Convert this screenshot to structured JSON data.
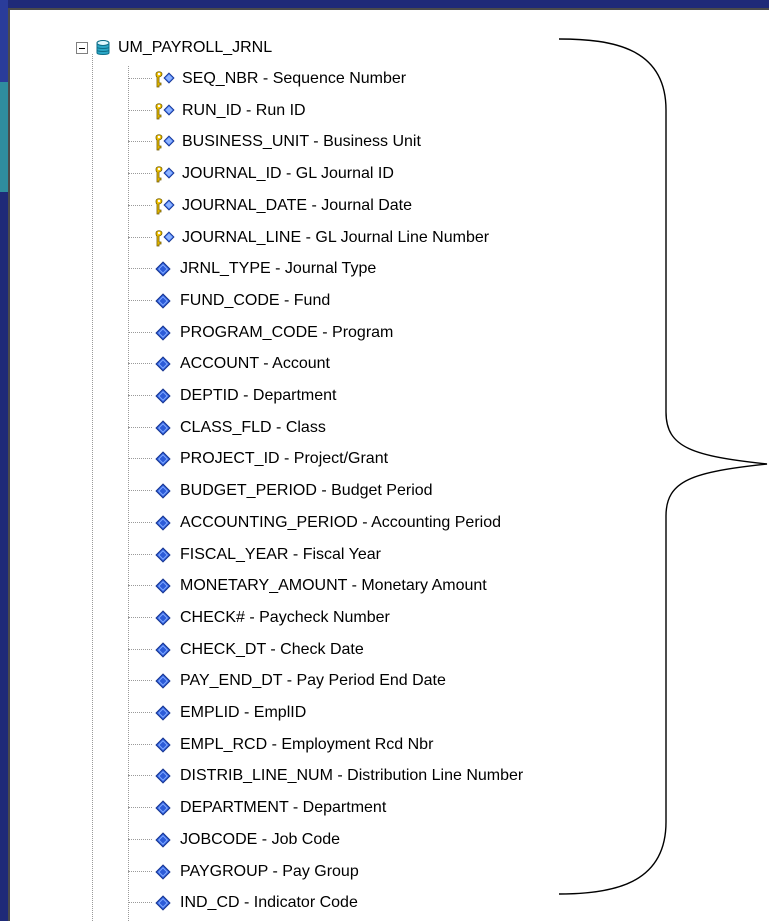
{
  "tree": {
    "root": "UM_PAYROLL_JRNL",
    "items": [
      {
        "label": "SEQ_NBR - Sequence Number",
        "is_key": true
      },
      {
        "label": "RUN_ID - Run ID",
        "is_key": true
      },
      {
        "label": "BUSINESS_UNIT - Business Unit",
        "is_key": true
      },
      {
        "label": "JOURNAL_ID - GL Journal ID",
        "is_key": true
      },
      {
        "label": "JOURNAL_DATE - Journal Date",
        "is_key": true
      },
      {
        "label": "JOURNAL_LINE - GL Journal Line Number",
        "is_key": true
      },
      {
        "label": "JRNL_TYPE - Journal Type",
        "is_key": false
      },
      {
        "label": "FUND_CODE - Fund",
        "is_key": false
      },
      {
        "label": "PROGRAM_CODE - Program",
        "is_key": false
      },
      {
        "label": "ACCOUNT - Account",
        "is_key": false
      },
      {
        "label": "DEPTID - Department",
        "is_key": false
      },
      {
        "label": "CLASS_FLD - Class",
        "is_key": false
      },
      {
        "label": "PROJECT_ID - Project/Grant",
        "is_key": false
      },
      {
        "label": "BUDGET_PERIOD - Budget Period",
        "is_key": false
      },
      {
        "label": "ACCOUNTING_PERIOD - Accounting Period",
        "is_key": false
      },
      {
        "label": "FISCAL_YEAR - Fiscal Year",
        "is_key": false
      },
      {
        "label": "MONETARY_AMOUNT - Monetary Amount",
        "is_key": false
      },
      {
        "label": "CHECK# - Paycheck Number",
        "is_key": false
      },
      {
        "label": "CHECK_DT - Check Date",
        "is_key": false
      },
      {
        "label": "PAY_END_DT - Pay Period End Date",
        "is_key": false
      },
      {
        "label": "EMPLID - EmplID",
        "is_key": false
      },
      {
        "label": "EMPL_RCD - Employment Rcd Nbr",
        "is_key": false
      },
      {
        "label": "DISTRIB_LINE_NUM - Distribution Line Number",
        "is_key": false
      },
      {
        "label": "DEPARTMENT - Department",
        "is_key": false
      },
      {
        "label": "JOBCODE - Job Code",
        "is_key": false
      },
      {
        "label": "PAYGROUP - Pay Group",
        "is_key": false
      },
      {
        "label": "IND_CD - Indicator Code",
        "is_key": false
      }
    ]
  },
  "colors": {
    "background": "#1f2a78",
    "panel": "#ffffff",
    "field_icon": "#2c5bd8",
    "key_icon": "#e8b400",
    "tree_lines": "#9a9a9a"
  },
  "icons": {
    "root": "database-icon",
    "key": "key-field-icon",
    "field": "field-diamond-icon",
    "expander": "collapse-minus-icon"
  }
}
